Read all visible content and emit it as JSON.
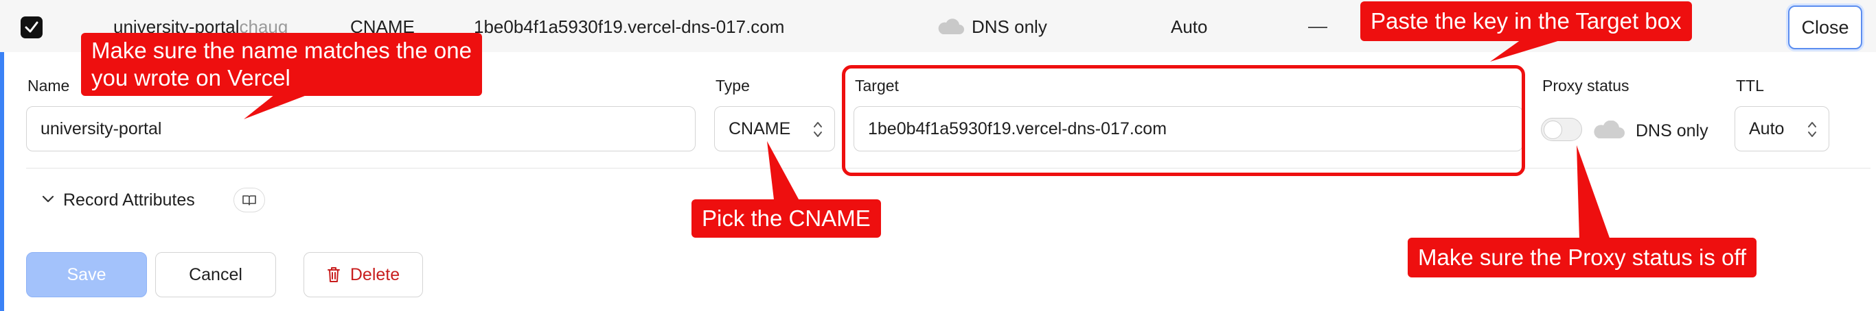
{
  "summary_row": {
    "name": "university-portal",
    "name_faded": "chaug",
    "type": "CNAME",
    "content": "1be0b4f1a5930f19.vercel-dns-017.com",
    "proxy_status": "DNS only",
    "ttl": "Auto",
    "dash": "—",
    "close_label": "Close"
  },
  "form": {
    "name_label": "Name",
    "name_value": "university-portal",
    "type_label": "Type",
    "type_value": "CNAME",
    "target_label": "Target",
    "target_value": "1be0b4f1a5930f19.vercel-dns-017.com",
    "proxy_label": "Proxy status",
    "proxy_value": "DNS only",
    "ttl_label": "TTL",
    "ttl_value": "Auto",
    "record_attributes_label": "Record Attributes"
  },
  "actions": {
    "save_label": "Save",
    "cancel_label": "Cancel",
    "delete_label": "Delete"
  },
  "annotations": {
    "name_note_line1": "Make sure the name matches the one",
    "name_note_line2": "you wrote on Vercel",
    "target_note": "Paste the key in the Target box",
    "type_note": "Pick the CNAME",
    "proxy_note": "Make sure the Proxy status is off"
  },
  "colors": {
    "annotation_red": "#ee0f0f",
    "accent_blue": "#3b82f6",
    "save_disabled": "#a3c2fb",
    "delete_red": "#c81e1e"
  },
  "icons": [
    "checkbox-checked-icon",
    "cloud-icon",
    "select-arrows-icon",
    "chevron-down-icon",
    "book-icon",
    "trash-icon"
  ]
}
